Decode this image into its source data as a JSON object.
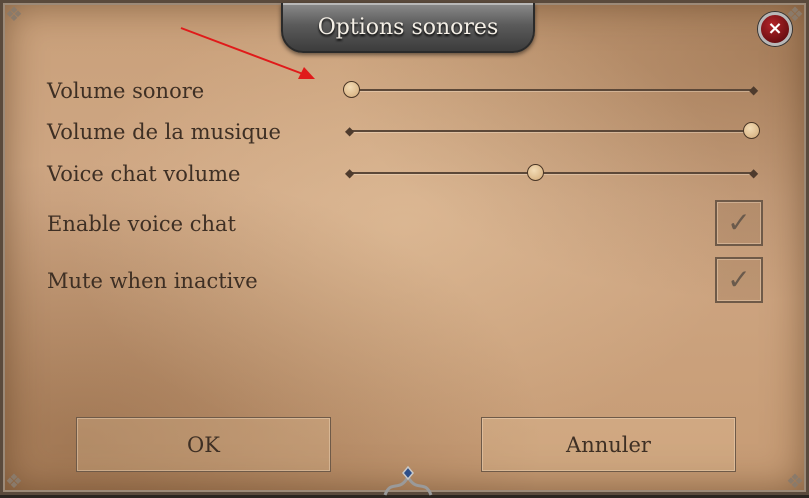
{
  "dialog": {
    "title": "Options sonores",
    "close_label": "×"
  },
  "sliders": [
    {
      "label": "Volume sonore",
      "value": 0.0
    },
    {
      "label": "Volume de la musique",
      "value": 1.0
    },
    {
      "label": "Voice chat volume",
      "value": 0.46
    }
  ],
  "checkboxes": [
    {
      "label": "Enable voice chat",
      "checked": true,
      "glyph": "✓"
    },
    {
      "label": "Mute when inactive",
      "checked": true,
      "glyph": "✓"
    }
  ],
  "buttons": {
    "ok": "OK",
    "cancel": "Annuler"
  },
  "colors": {
    "parchment": "#cfa784",
    "text": "#3e2f24",
    "close_red": "#8e1418",
    "annotation_arrow": "#e01a1a"
  },
  "icons": {
    "close": "close-icon",
    "check": "checkmark-icon",
    "corner": "ornament-corner-icon",
    "annotation": "red-arrow-icon"
  }
}
